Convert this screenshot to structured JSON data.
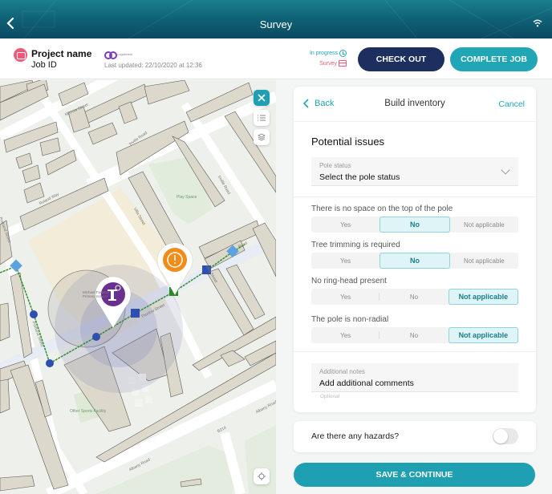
{
  "topbar": {
    "title": "Survey",
    "back_icon": "chevron-left-icon",
    "status_icon": "wifi-icon"
  },
  "job": {
    "project_name": "Project name",
    "job_id": "Job ID",
    "logo_text": "Logobrand",
    "last_updated": "Last updated: 22/10/2020 at 12:36",
    "status_progress": "In progress",
    "status_type": "Survey",
    "checkout_label": "CHECK OUT",
    "complete_label": "COMPLETE JOB",
    "colors": {
      "primary": "#1d2f5e",
      "accent": "#21a6b6",
      "pink": "#ef5a78"
    }
  },
  "map": {
    "labels": {
      "merrow": "Merrow Street",
      "invillel": "Inville Road",
      "inviller": "Inville Road",
      "roland": "Roland Way",
      "portland": "Portland Street",
      "villa1": "Villa Street",
      "villa2": "Villa Street",
      "play": "Play Space",
      "school": "Michael Faraday Primary School",
      "sports": "Other Sports Facility",
      "albany1": "Albany Road",
      "albany2": "Albany Road",
      "b214": "B214",
      "road": "Road",
      "thurlow": "Thurlow Street"
    },
    "controls": {
      "close": "close-icon",
      "list": "list-icon",
      "layers": "layers-icon",
      "locate": "locate-icon"
    }
  },
  "panel": {
    "back_label": "Back",
    "title": "Build inventory",
    "cancel_label": "Cancel",
    "section_title": "Potential issues",
    "pole_status": {
      "label": "Pole status",
      "value": "Select the pole status"
    },
    "questions": [
      {
        "label": "There is no space on the top of the pole",
        "options": [
          "Yes",
          "No",
          "Not applicable"
        ],
        "selected": "No"
      },
      {
        "label": "Tree trimming is required",
        "options": [
          "Yes",
          "No",
          "Not applicable"
        ],
        "selected": "No"
      },
      {
        "label": "No ring-head present",
        "options": [
          "Yes",
          "No",
          "Not applicable"
        ],
        "selected": "Not applicable"
      },
      {
        "label": "The pole is non-radial",
        "options": [
          "Yes",
          "No",
          "Not applicable"
        ],
        "selected": "Not applicable"
      }
    ],
    "notes": {
      "label": "Additional notes",
      "value": "Add additional comments",
      "hint": "Optional"
    }
  },
  "hazards": {
    "label": "Are there any hazards?",
    "enabled": false
  },
  "save_label": "SAVE & CONTINUE"
}
